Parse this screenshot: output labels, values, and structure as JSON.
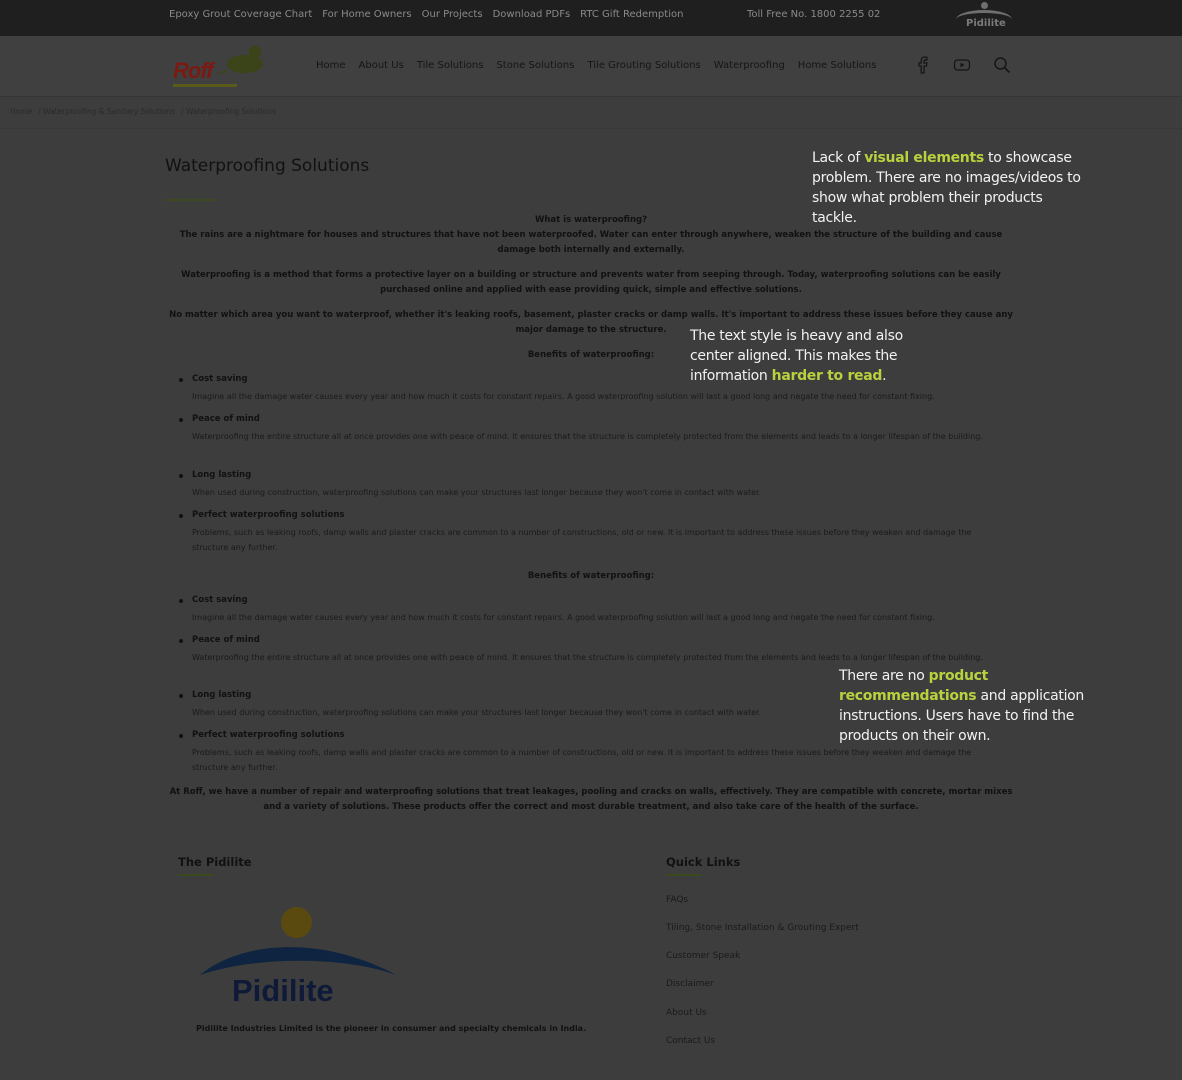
{
  "topbar": {
    "links": [
      "Epoxy Grout Coverage Chart",
      "For Home Owners",
      "Our Projects",
      "Download PDFs",
      "RTC Gift Redemption"
    ],
    "toll_free": "Toll Free No. 1800 2255 02",
    "brand": "Pidilite"
  },
  "header": {
    "logo_text": "Roff",
    "nav": [
      "Home",
      "About Us",
      "Tile Solutions",
      "Stone Solutions",
      "Tile Grouting Solutions",
      "Waterproofing",
      "Home Solutions"
    ],
    "icons": [
      "facebook-icon",
      "youtube-icon",
      "search-icon"
    ]
  },
  "breadcrumb": {
    "items": [
      "Home",
      "/ Waterproofing & Sanitary Solutions",
      "/ Waterproofing Solutions"
    ]
  },
  "main": {
    "title": "Waterproofing Solutions",
    "q_heading": "What is waterproofing?",
    "p1": "The rains are a nightmare for houses and structures that have not been waterproofed. Water can enter through anywhere, weaken the structure of the building and cause damage both internally and externally.",
    "p2": "Waterproofing is a method that forms a protective layer on a building or structure and prevents water from seeping through. Today, waterproofing solutions can be easily purchased online and applied with ease providing quick, simple and effective solutions.",
    "p3": "No matter which area you want to waterproof, whether it's leaking roofs, basement, plaster cracks or damp walls. It's important to address these issues before they cause any major damage to the structure.",
    "benefits_heading": "Benefits of waterproofing:",
    "benefits": [
      {
        "title": "Cost saving",
        "desc": "Imagine all the damage water causes every year and how much it costs for constant repairs. A good waterproofing solution will last a good long and negate the need for constant fixing."
      },
      {
        "title": "Peace of mind",
        "desc": "Waterproofing the entire structure all at once provides one with peace of mind. It ensures that the structure is completely protected from the elements and leads to a longer lifespan of the building."
      },
      {
        "title": "Long lasting",
        "desc": "When used during construction, waterproofing solutions can make your structures last longer because they won't come in contact with water."
      },
      {
        "title": "Perfect waterproofing solutions",
        "desc": "Problems, such as leaking roofs, damp walls and plaster cracks are common to a number of constructions, old or new. It is important to address these issues before they weaken and damage the structure any further."
      }
    ],
    "closing": "At Roff, we have a number of repair and waterproofing solutions that treat leakages, pooling and cracks on walls, effectively. They are compatible with concrete, mortar mixes and a variety of solutions. These products offer the correct and most durable treatment, and also take care of the health of the surface."
  },
  "footer": {
    "about_heading": "The Pidilite",
    "pidilite_logo": "Pidilite",
    "about_text": "Pidilite Industries Limited is the pioneer in consumer and specialty chemicals in India.",
    "links_heading": "Quick Links",
    "links": [
      "FAQs",
      "Tiling, Stone Installation & Grouting Expert",
      "Customer Speak",
      "Disclaimer",
      "About Us",
      "Contact Us"
    ]
  },
  "annotations": {
    "a1": {
      "pre": "Lack of ",
      "hl": "visual elements",
      "post": " to showcase problem. There are no images/videos to show what problem their products tackle."
    },
    "a2": {
      "pre": "The text style is heavy and also center aligned. This makes the information ",
      "hl": "harder to read",
      "post": "."
    },
    "a3": {
      "pre": "There are no ",
      "hl": "product recommendations",
      "post": " and application instructions. Users have to find the products on their own."
    },
    "highlight_color": "#b8d23e"
  }
}
